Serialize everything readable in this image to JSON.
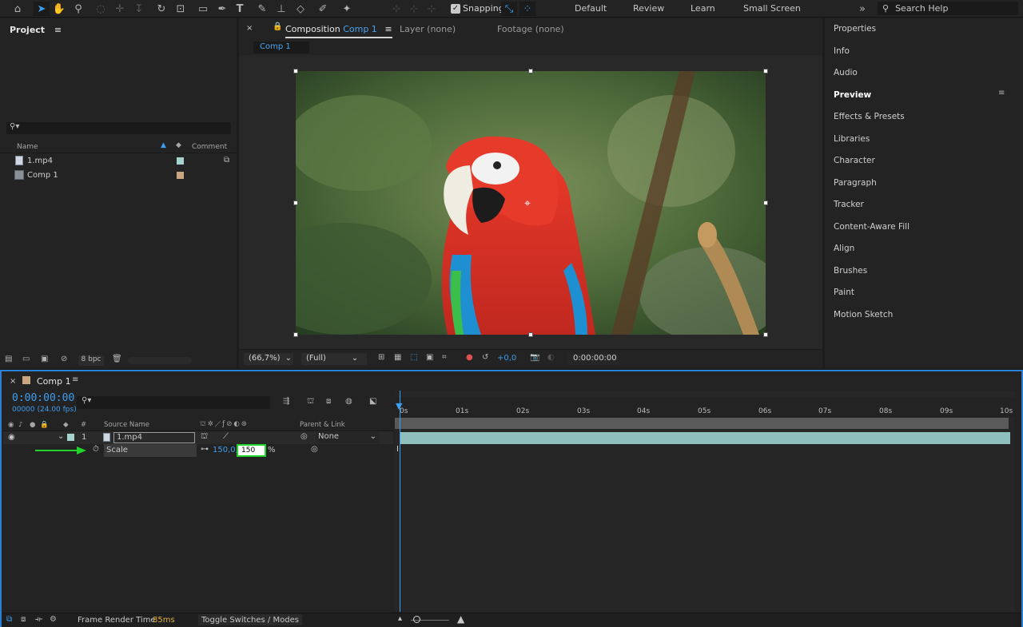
{
  "toolbar": {
    "snapping_label": "Snapping",
    "workspaces": [
      "Default",
      "Review",
      "Learn",
      "Small Screen"
    ],
    "search_help_placeholder": "Search Help"
  },
  "project": {
    "title": "Project",
    "columns": {
      "name": "Name",
      "comment": "Comment"
    },
    "items": [
      {
        "name": "1.mp4",
        "label_color": "#a7d3cf"
      },
      {
        "name": "Comp 1",
        "label_color": "#c9a67f"
      }
    ],
    "bpc": "8 bpc"
  },
  "viewer": {
    "tabs": {
      "composition_prefix": "Composition",
      "composition_name": "Comp 1",
      "layer": "Layer (none)",
      "footage": "Footage (none)"
    },
    "subtab": "Comp 1",
    "zoom": "(66,7%)",
    "resolution": "(Full)",
    "exposure": "+0,0",
    "timecode": "0:00:00:00"
  },
  "right_panels": {
    "items": [
      "Properties",
      "Info",
      "Audio",
      "Preview",
      "Effects & Presets",
      "Libraries",
      "Character",
      "Paragraph",
      "Tracker",
      "Content-Aware Fill",
      "Align",
      "Brushes",
      "Paint",
      "Motion Sketch"
    ],
    "active": "Preview"
  },
  "timeline": {
    "tab": "Comp 1",
    "time": "0:00:00:00",
    "fps": "00000 (24.00 fps)",
    "columns": {
      "num": "#",
      "source": "Source Name",
      "parent": "Parent & Link"
    },
    "layer": {
      "index": "1",
      "name": "1.mp4",
      "parent": "None",
      "label_color": "#a7d3cf"
    },
    "property": {
      "name": "Scale",
      "value_x": "150,0,",
      "value_y_input": "150",
      "unit": "%"
    },
    "ruler_ticks": [
      "0s",
      "01s",
      "02s",
      "03s",
      "04s",
      "05s",
      "06s",
      "07s",
      "08s",
      "09s",
      "10s"
    ],
    "footer": {
      "render_label": "Frame Render Time",
      "render_value": "85ms",
      "toggle": "Toggle Switches / Modes"
    }
  },
  "colors": {
    "accent": "#2b7fd4",
    "annotation_arrow": "#22d42a",
    "highlight_box": "#22d42a"
  }
}
